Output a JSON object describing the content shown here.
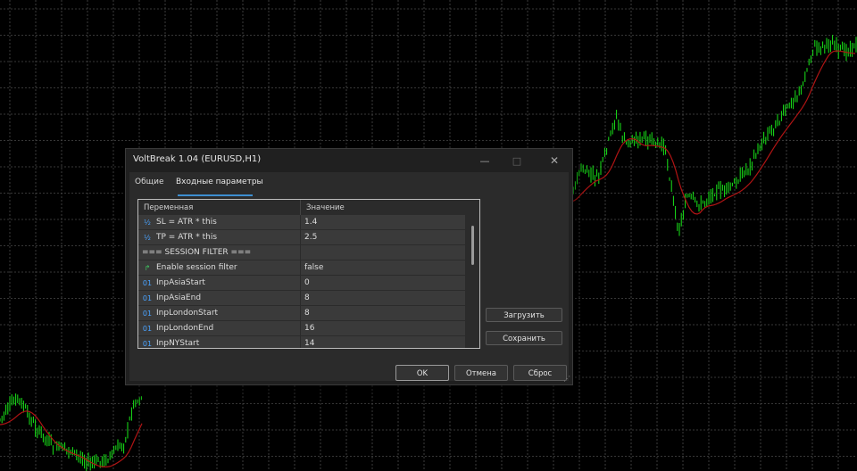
{
  "dialog": {
    "title": "VoltBreak 1.04 (EURUSD,H1)",
    "controls": {
      "minimize": "—",
      "maximize": "□",
      "close": "✕"
    }
  },
  "tabs": [
    {
      "label": "Общие",
      "active": false
    },
    {
      "label": "Входные параметры",
      "active": true
    }
  ],
  "table": {
    "headers": {
      "variable": "Переменная",
      "value": "Значение"
    },
    "rows": [
      {
        "icon": "fraction-icon",
        "glyph": "½",
        "name": "SL = ATR * this",
        "value": "1.4"
      },
      {
        "icon": "fraction-icon",
        "glyph": "½",
        "name": "TP = ATR * this",
        "value": "2.5"
      },
      {
        "icon": "",
        "glyph": "",
        "name": "=== SESSION FILTER ===",
        "value": ""
      },
      {
        "icon": "boolean-icon",
        "glyph": "↱",
        "name": "Enable session filter",
        "value": "false"
      },
      {
        "icon": "integer-icon",
        "glyph": "01",
        "name": "InpAsiaStart",
        "value": "0"
      },
      {
        "icon": "integer-icon",
        "glyph": "01",
        "name": "InpAsiaEnd",
        "value": "8"
      },
      {
        "icon": "integer-icon",
        "glyph": "01",
        "name": "InpLondonStart",
        "value": "8"
      },
      {
        "icon": "integer-icon",
        "glyph": "01",
        "name": "InpLondonEnd",
        "value": "16"
      },
      {
        "icon": "integer-icon",
        "glyph": "01",
        "name": "InpNYStart",
        "value": "14"
      }
    ]
  },
  "side_buttons": {
    "load": "Загрузить",
    "save": "Сохранить"
  },
  "footer_buttons": {
    "ok": "OK",
    "cancel": "Отмена",
    "reset": "Сброс"
  },
  "colors": {
    "chart_background": "#000000",
    "grid": "#4a4a4a",
    "candles": "#19e619",
    "moving_average": "#b01414",
    "tab_accent": "#3d8fd1"
  }
}
